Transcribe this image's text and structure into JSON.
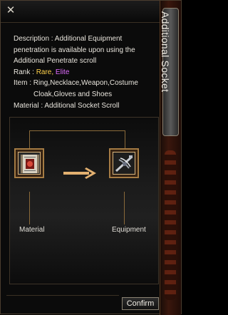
{
  "window": {
    "title": "Additional Socket",
    "close_icon": "close-icon"
  },
  "description": {
    "line1": "Description : Additional Equipment",
    "line2": "penetration is available upon using the",
    "line3": "Additional Penetrate scroll",
    "rank_label": "Rank : ",
    "rank_rare": "Rare,",
    "rank_elite": "Elite",
    "item_label": "Item : ",
    "item_line1": "Ring,Necklace,Weapon,Costume",
    "item_line2": "Cloak,Gloves and Shoes",
    "material_label": "Material : ",
    "material_value": "Additional Socket Scroll"
  },
  "craft": {
    "material_label": "Material",
    "equipment_label": "Equipment",
    "material_icon": "scroll-icon",
    "equipment_icon": "crossbow-icon",
    "arrow_icon": "right-arrow-icon"
  },
  "buttons": {
    "confirm": "Confirm"
  },
  "colors": {
    "rare": "#ffd24a",
    "elite": "#e06cff",
    "frame_gold": "#a67c44",
    "arrow": "#e2b070"
  }
}
